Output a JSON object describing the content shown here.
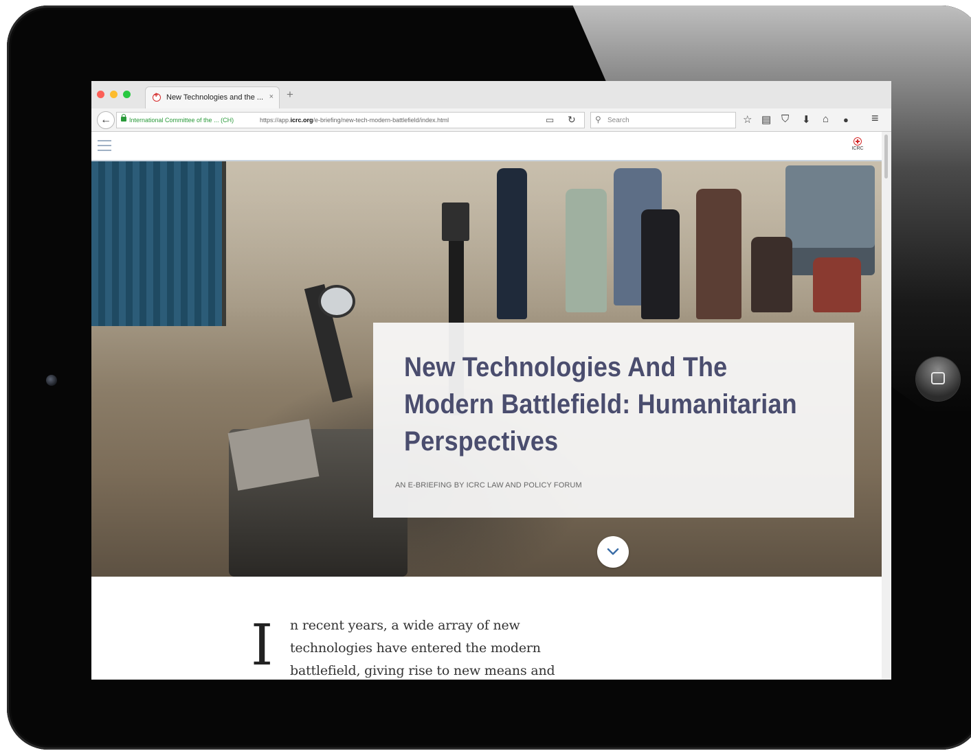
{
  "browser": {
    "tab": {
      "title": "New Technologies and the ...",
      "close_glyph": "×"
    },
    "new_tab_glyph": "+",
    "back_glyph": "←",
    "identity": "International Committee of the ... (CH)",
    "url_prefix": "https://app.",
    "url_domain": "icrc.org",
    "url_path": "/e-briefing/new-tech-modern-battlefield/index.html",
    "reader_glyph": "▭",
    "reload_glyph": "↻",
    "search_placeholder": "Search",
    "toolbar_icons": [
      "star-icon",
      "library-icon",
      "pocket-icon",
      "download-icon",
      "home-icon",
      "chat-icon",
      "menu-icon"
    ],
    "toolbar_glyphs": [
      "☆",
      "▤",
      "⛉",
      "⬇",
      "⌂",
      "●",
      "≡"
    ]
  },
  "site": {
    "logo_text": "ICRC",
    "accent": "#d42a2a"
  },
  "hero": {
    "title": "New Technologies And The Modern Battlefield: Humanitarian Perspectives",
    "subtitle": "AN E-BRIEFING BY ICRC LAW AND POLICY FORUM",
    "title_color": "#4a4d6e"
  },
  "article": {
    "drop_cap": "I",
    "lines": [
      "n recent years, a wide array of new",
      "technologies have entered the modern",
      "battlefield, giving rise to new means and"
    ]
  }
}
